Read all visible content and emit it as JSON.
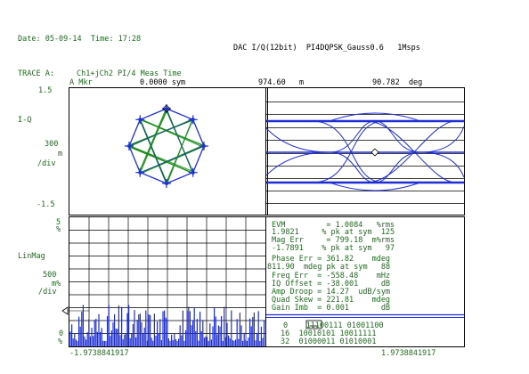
{
  "header": {
    "date_time": "Date: 05-09-14  Time: 17:28",
    "title": "DAC I/Q(12bit)  PI4DQPSK_Gauss0.6   1Msps",
    "trace_label": "TRACE A:",
    "trace_desc": "Ch1+jCh2 PI/4 Meas Time",
    "marker_label": "A Mkr",
    "marker_sym": "0.0000 sym",
    "marker_mag": "974.60   m",
    "marker_deg": "90.782  deg"
  },
  "iq_panel": {
    "top_value": "1.5",
    "name": "I-Q",
    "scale": "300",
    "scale_unit": "m",
    "per_div": "/div",
    "bottom_value": "-1.5"
  },
  "mag_panel": {
    "top_value": "5",
    "top_unit": "%",
    "name": "LinMag",
    "scale": "500",
    "scale_unit": "m%",
    "per_div": "/div",
    "bottom_value": "0",
    "bottom_unit": "%",
    "x_left": "-1.9738841917",
    "x_right": "1.9738841917"
  },
  "measurements": [
    "EVM         = 1.0084   %rms",
    "1.9821     % pk at sym  125",
    "Mag Err     = 799.18  m%rms",
    "-1.7891    % pk at sym   97",
    "Phase Err = 361.82    mdeg",
    "811.90  mdeg pk at sym   88",
    "Freq Err  = -558.48    mHz",
    "IQ Offset = -38.001     dB",
    "Amp Droop = 14.27  udB/sym",
    "Quad Skew = 221.81    mdeg",
    "Gain Imb  = 0.001       dB"
  ],
  "symbols": [
    "0    11100111 01001100",
    "16  10010101 10011111",
    "32  01000011 01010001"
  ],
  "colors": {
    "trace_blue": "#1e2fd6",
    "trace_green": "#1c8f1c",
    "text_green": "#1f6b1f",
    "grid": "#000000"
  }
}
